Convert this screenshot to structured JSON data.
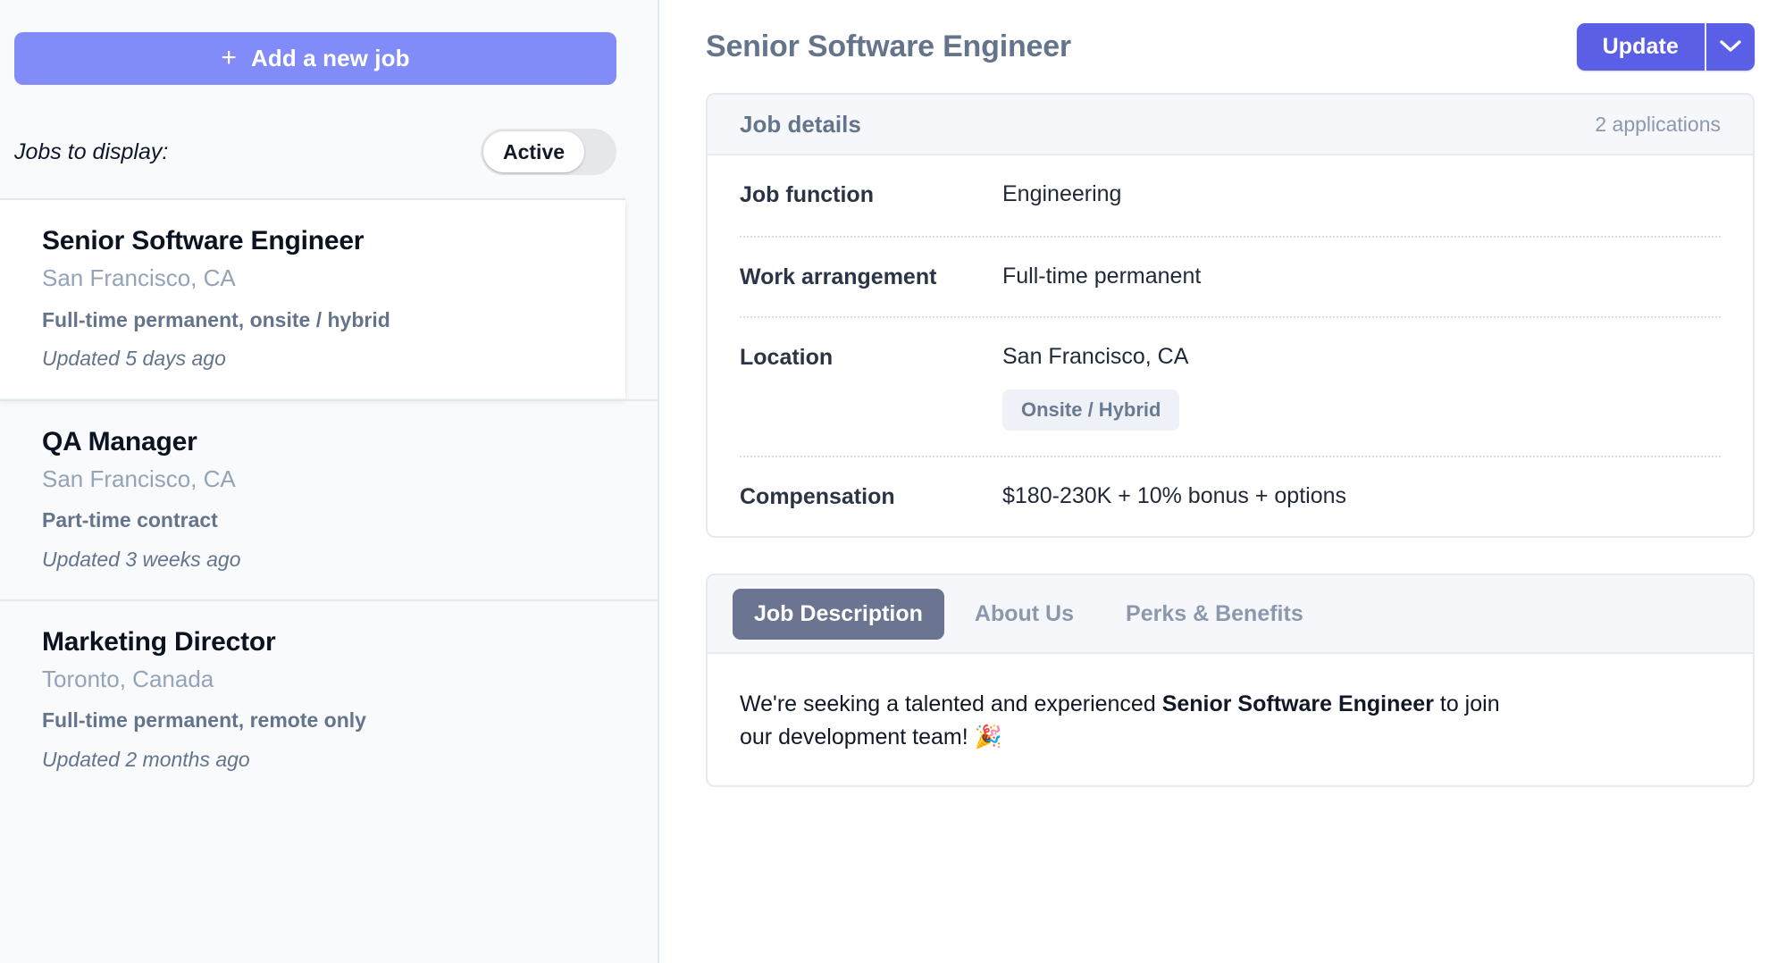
{
  "sidebar": {
    "add_job_button": "Add a new job",
    "add_job_icon": "plus-icon",
    "jobs_to_display_label": "Jobs to display:",
    "toggle": {
      "state_label": "Active"
    },
    "jobs": [
      {
        "title": "Senior Software Engineer",
        "location": "San Francisco, CA",
        "type": "Full-time permanent, onsite / hybrid",
        "updated": "Updated 5 days ago",
        "selected": true
      },
      {
        "title": "QA Manager",
        "location": "San Francisco, CA",
        "type": "Part-time contract",
        "updated": "Updated 3 weeks ago",
        "selected": false
      },
      {
        "title": "Marketing Director",
        "location": "Toronto, Canada",
        "type": "Full-time permanent, remote only",
        "updated": "Updated 2 months ago",
        "selected": false
      }
    ]
  },
  "main": {
    "page_title": "Senior Software Engineer",
    "update_button": "Update",
    "update_caret_icon": "chevron-down-icon",
    "details_card": {
      "header_title": "Job details",
      "header_meta": "2 applications",
      "rows": [
        {
          "label": "Job function",
          "value": "Engineering"
        },
        {
          "label": "Work arrangement",
          "value": "Full-time permanent"
        },
        {
          "label": "Location",
          "value": "San Francisco, CA",
          "badge": "Onsite / Hybrid"
        },
        {
          "label": "Compensation",
          "value": "$180-230K + 10% bonus + options"
        }
      ]
    },
    "tabs": [
      {
        "label": "Job Description",
        "active": true
      },
      {
        "label": "About Us",
        "active": false
      },
      {
        "label": "Perks & Benefits",
        "active": false
      }
    ],
    "description": {
      "lead": "We're seeking a talented and experienced ",
      "emphasis": "Senior Software Engineer",
      "trail": " to join our development team! 🎉"
    }
  },
  "colors": {
    "add_job_button_bg": "#818cf8",
    "update_button_bg": "#5b5fe6",
    "active_tab_bg": "#6b7490",
    "badge_bg": "#eef1f7",
    "sidebar_bg": "#f8fafc",
    "card_header_bg": "#f5f7fa"
  }
}
